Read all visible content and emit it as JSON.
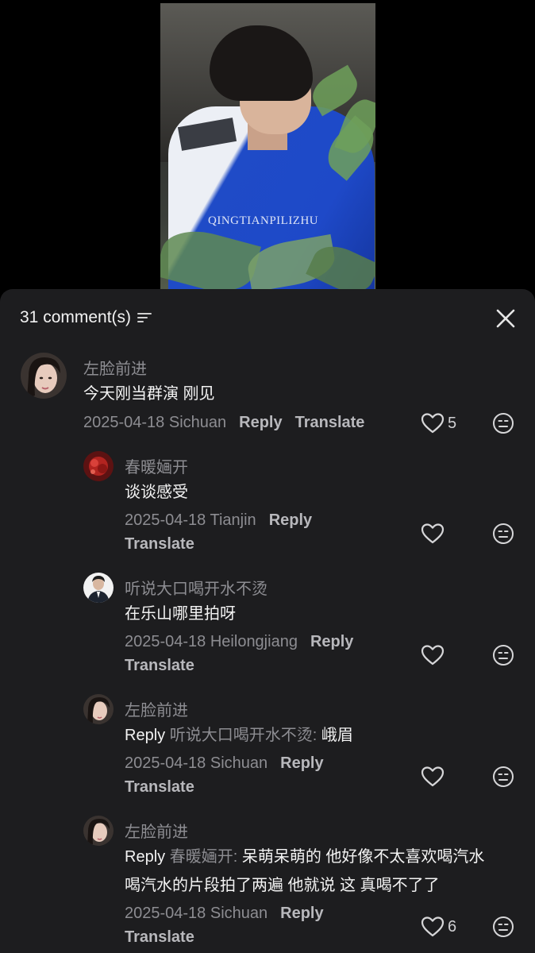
{
  "video": {
    "watermark": "QINGTIANPILIZHU"
  },
  "header": {
    "count_label": "31 comment(s)",
    "sort_icon": "sort-filter-icon",
    "close_icon": "close-icon"
  },
  "comments": [
    {
      "user": "左脸前进",
      "text": "今天刚当群演 刚见",
      "date_location": "2025-04-18 Sichuan",
      "reply_label": "Reply",
      "translate_label": "Translate",
      "likes": "5"
    },
    {
      "user": "春暖婳开",
      "text": "谈谈感受",
      "date_location": "2025-04-18 Tianjin",
      "reply_label": "Reply",
      "translate_label": "Translate"
    },
    {
      "user": "听说大口喝开水不烫",
      "text": "在乐山哪里拍呀",
      "date_location": "2025-04-18 Heilongjiang",
      "reply_label": "Reply",
      "translate_label": "Translate"
    },
    {
      "user": "左脸前进",
      "reply_word": "Reply",
      "reply_to": "听说大口喝开水不烫:",
      "text": " 峨眉",
      "date_location": "2025-04-18 Sichuan",
      "reply_label": "Reply",
      "translate_label": "Translate"
    },
    {
      "user": "左脸前进",
      "reply_word": "Reply",
      "reply_to": "春暖婳开:",
      "text_line1": " 呆萌呆萌的 他好像不太喜欢喝汽水",
      "text_line2": "喝汽水的片段拍了两遍 他就说 这 真喝不了了",
      "date_location": "2025-04-18 Sichuan",
      "reply_label": "Reply",
      "translate_label": "Translate",
      "likes": "6"
    }
  ],
  "colors": {
    "sheet_bg": "#1d1d1f",
    "muted_text": "#8d8d92",
    "primary_text": "#f3f3f3"
  }
}
